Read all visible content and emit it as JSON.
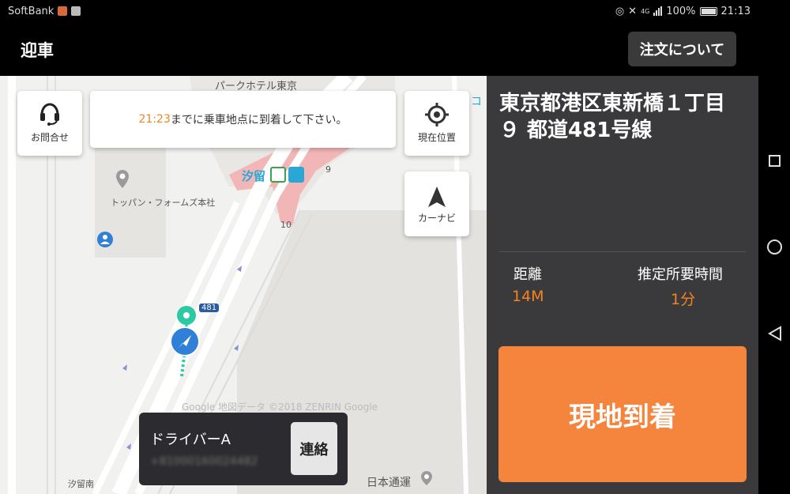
{
  "status_bar": {
    "carrier": "SoftBank",
    "network": "4G",
    "battery": "100%",
    "time": "21:13"
  },
  "app_bar": {
    "title": "迎車",
    "order_button": "注文について"
  },
  "map": {
    "contact_label": "お問合せ",
    "notice_time": "21:23",
    "notice_text": "までに乗車地点に到着して下さい。",
    "location_label": "現在位置",
    "navi_label": "カーナビ",
    "places": {
      "hotel": "パークホテル東京",
      "station": "汐留",
      "toppan": "トッパン・フォームズ本社",
      "nittsu": "日本通運",
      "shiodome_minami": "汐留南",
      "road_481": "481",
      "block_9": "9",
      "block_10": "10",
      "edge_ko": "コ"
    },
    "watermark": "Google 地図データ ©2018 ZENRIN Google"
  },
  "driver": {
    "name": "ドライバーA",
    "phone": "+81000160024482",
    "contact_button": "連絡"
  },
  "panel": {
    "address": "東京都港区東新橋１丁目９ 都道481号線",
    "distance_label": "距離",
    "distance_value": "14M",
    "eta_label": "推定所要時間",
    "eta_value": "1分",
    "arrive_button": "現地到着"
  },
  "colors": {
    "accent": "#f5841f",
    "arrive_button": "#f5843c",
    "panel_bg": "#3a3a3c",
    "pin_green": "#2bc9a4",
    "pin_blue": "#2f80d6"
  }
}
